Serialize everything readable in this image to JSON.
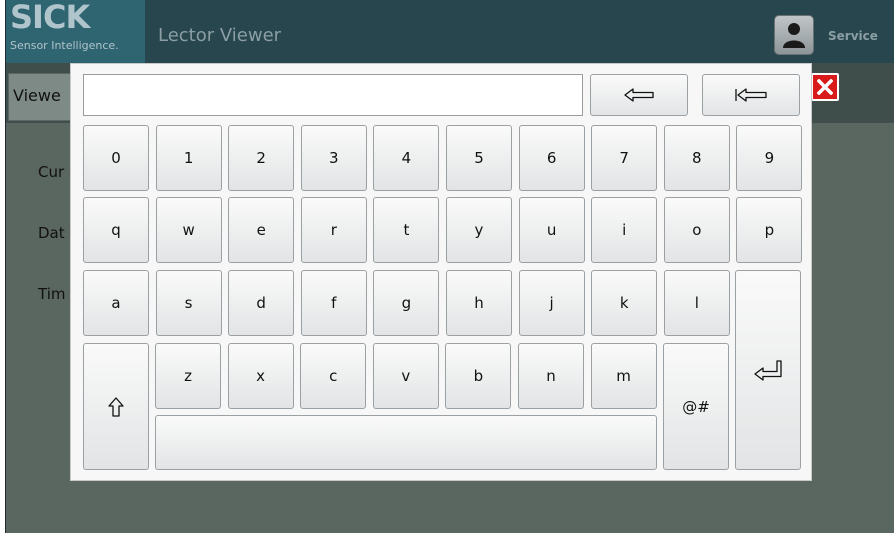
{
  "header": {
    "logo_text": "SICK",
    "logo_subtitle": "Sensor Intelligence.",
    "title": "Lector Viewer",
    "user_icon": "user-icon",
    "service_label": "Service"
  },
  "tabs": {
    "viewer_label": "Viewe"
  },
  "background_labels": {
    "current": "Cur",
    "date": "Dat",
    "time": "Tim"
  },
  "keyboard": {
    "input_value": "",
    "row_digits": [
      "0",
      "1",
      "2",
      "3",
      "4",
      "5",
      "6",
      "7",
      "8",
      "9"
    ],
    "row_q": [
      "q",
      "w",
      "e",
      "r",
      "t",
      "y",
      "u",
      "i",
      "o",
      "p"
    ],
    "row_a": [
      "a",
      "s",
      "d",
      "f",
      "g",
      "h",
      "j",
      "k",
      "l"
    ],
    "row_z": [
      "z",
      "x",
      "c",
      "v",
      "b",
      "n",
      "m"
    ],
    "symbols_label": "@#",
    "backspace_icon": "backspace-arrow-icon",
    "clear_icon": "clear-all-arrow-icon",
    "shift_icon": "shift-arrow-icon",
    "enter_icon": "enter-return-icon"
  },
  "colors": {
    "header_bg": "#27464d",
    "logo_bg": "#2f6471",
    "close_red": "#d81a1a",
    "body_bg": "#5a6660"
  }
}
